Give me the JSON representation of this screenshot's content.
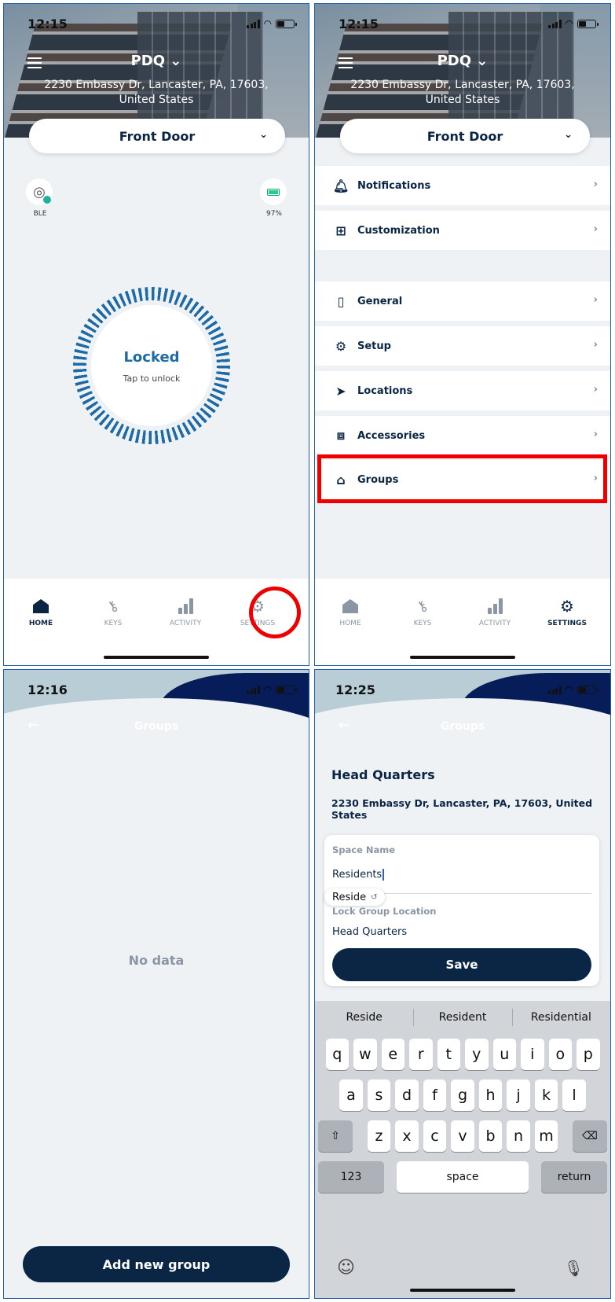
{
  "panel1": {
    "status_time": "12:15",
    "property_title": "PDQ",
    "address": "2230 Embassy Dr, Lancaster, PA, 17603, United States",
    "door_selector": "Front Door",
    "ble_label": "BLE",
    "battery_label": "97%",
    "lock_state": "Locked",
    "lock_hint": "Tap to unlock",
    "tabs": [
      "HOME",
      "KEYS",
      "ACTIVITY",
      "SETTINGS"
    ],
    "active_tab": "HOME",
    "highlight": "settings-tab"
  },
  "panel2": {
    "status_time": "12:15",
    "property_title": "PDQ",
    "address": "2230 Embassy Dr, Lancaster, PA, 17603, United States",
    "door_selector": "Front Door",
    "settings_items": [
      {
        "label": "Notifications",
        "icon": "bell-icon"
      },
      {
        "label": "Customization",
        "icon": "grid-plus-icon"
      },
      {
        "label": "General",
        "icon": "phone-icon"
      },
      {
        "label": "Setup",
        "icon": "gear-icon"
      },
      {
        "label": "Locations",
        "icon": "navigation-icon"
      },
      {
        "label": "Accessories",
        "icon": "toolbox-icon"
      },
      {
        "label": "Groups",
        "icon": "house-outline-icon"
      }
    ],
    "tabs": [
      "HOME",
      "KEYS",
      "ACTIVITY",
      "SETTINGS"
    ],
    "active_tab": "SETTINGS",
    "highlight": "Groups"
  },
  "panel3": {
    "status_time": "12:16",
    "title": "Groups",
    "empty_text": "No data",
    "add_button": "Add new group"
  },
  "panel4": {
    "status_time": "12:25",
    "title": "Groups",
    "location_name": "Head Quarters",
    "location_address": "2230 Embassy Dr, Lancaster, PA, 17603, United States",
    "space_name_label": "Space Name",
    "space_name_value": "Residents",
    "autocorrect": "Reside",
    "lock_group_label": "Lock Group Location",
    "lock_group_value": "Head Quarters",
    "save_button": "Save",
    "suggestions": [
      "Reside",
      "Resident",
      "Residential"
    ],
    "keyboard_row1": [
      "q",
      "w",
      "e",
      "r",
      "t",
      "y",
      "u",
      "i",
      "o",
      "p"
    ],
    "keyboard_row2": [
      "a",
      "s",
      "d",
      "f",
      "g",
      "h",
      "j",
      "k",
      "l"
    ],
    "keyboard_row3": [
      "z",
      "x",
      "c",
      "v",
      "b",
      "n",
      "m"
    ],
    "key_123": "123",
    "key_space": "space",
    "key_return": "return"
  },
  "colors": {
    "navy": "#0b2545",
    "accent_blue": "#1e6aa6",
    "highlight_red": "#e00000",
    "battery_green": "#1fcf8f"
  }
}
